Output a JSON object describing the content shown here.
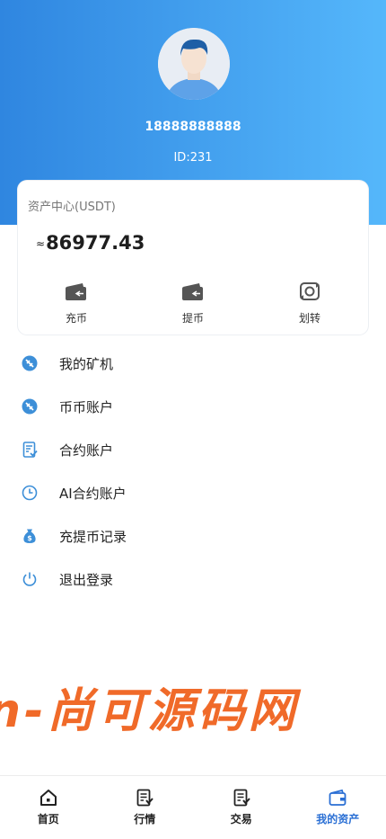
{
  "profile": {
    "phone": "18888888888",
    "id_text": "ID:231"
  },
  "asset": {
    "title": "资产中心(USDT)",
    "approx": "≈",
    "amount": "86977.43"
  },
  "actions": [
    {
      "label": "充币",
      "icon": "wallet-icon"
    },
    {
      "label": "提币",
      "icon": "wallet-icon"
    },
    {
      "label": "划转",
      "icon": "transfer-icon"
    }
  ],
  "menu": [
    {
      "label": "我的矿机",
      "icon": "mining-icon"
    },
    {
      "label": "币币账户",
      "icon": "coin-account-icon"
    },
    {
      "label": "合约账户",
      "icon": "contract-icon"
    },
    {
      "label": "AI合约账户",
      "icon": "clock-icon"
    },
    {
      "label": "充提币记录",
      "icon": "money-bag-icon"
    },
    {
      "label": "退出登录",
      "icon": "power-icon"
    }
  ],
  "watermark": "n-尚可源码网",
  "tabs": [
    {
      "label": "首页",
      "icon": "home-icon"
    },
    {
      "label": "行情",
      "icon": "market-icon"
    },
    {
      "label": "交易",
      "icon": "trade-icon"
    },
    {
      "label": "我的资产",
      "icon": "wallet-icon",
      "active": true
    }
  ],
  "colors": {
    "header_start": "#2f86e0",
    "header_end": "#55b7fb",
    "accent": "#3d8fd8",
    "watermark": "#f06a29",
    "active_tab": "#2a6fd4"
  }
}
